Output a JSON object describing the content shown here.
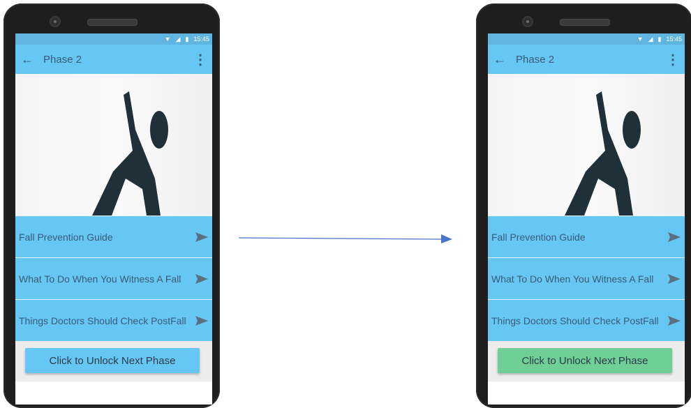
{
  "phones": {
    "before": {
      "status_time": "15:45",
      "title": "Phase 2",
      "menu_items": [
        "Fall Prevention Guide",
        "What To Do When You Witness A Fall",
        "Things Doctors Should Check PostFall"
      ],
      "unlock_label": "Click to Unlock Next Phase",
      "unlock_color": "#66c7f4"
    },
    "after": {
      "status_time": "15:45",
      "title": "Phase 2",
      "menu_items": [
        "Fall Prevention Guide",
        "What To Do When You Witness A Fall",
        "Things Doctors Should Check PostFall"
      ],
      "unlock_label": "Click to Unlock Next Phase",
      "unlock_color": "#6fcf97"
    }
  },
  "icons": {
    "status": [
      "wifi-icon",
      "signal-icon",
      "battery-icon"
    ],
    "app_bar": [
      "back-arrow-icon",
      "overflow-menu-icon"
    ],
    "menu_item": "send-arrow-icon",
    "transition": "right-arrow"
  },
  "colors": {
    "app_bar": "#66c7f4",
    "status_bar": "#5fb5e0",
    "figure": "#1f3038",
    "arrow_line": "#4a74c9"
  }
}
